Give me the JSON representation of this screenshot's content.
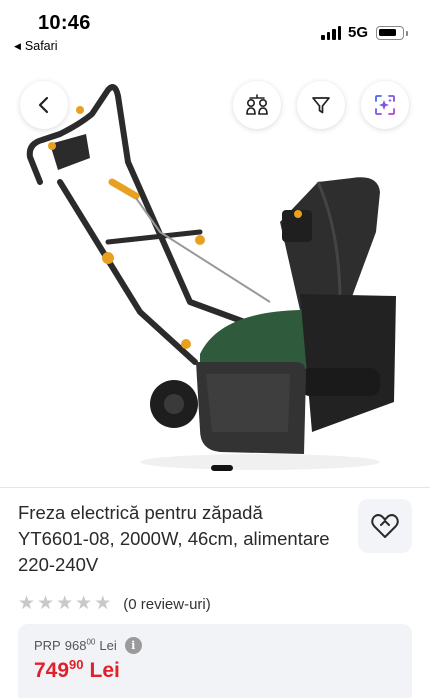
{
  "status_bar": {
    "time": "10:46",
    "back_app": "Safari",
    "network": "5G"
  },
  "gallery": {
    "icons": {
      "back": "chevron-left-icon",
      "compare": "compare-icon",
      "filter": "filter-icon",
      "ai": "ai-sparkle-icon"
    },
    "image_alt": "Freza electrică pentru zăpadă",
    "colors": {
      "body_green": "#2f5a3c",
      "accent_orange": "#e8a020"
    }
  },
  "product": {
    "title": "Freza electrică pentru zăpadă YT6601-08, 2000W, 46cm, alimentare 220-240V",
    "rating_stars": 0,
    "reviews": "(0 review-uri)"
  },
  "price": {
    "prp_label": "PRP",
    "prp_int": "968",
    "prp_dec": "00",
    "prp_currency": "Lei",
    "info_icon": "i",
    "price_int": "749",
    "price_dec": "90",
    "price_currency": "Lei",
    "price_color": "#e0202a"
  }
}
